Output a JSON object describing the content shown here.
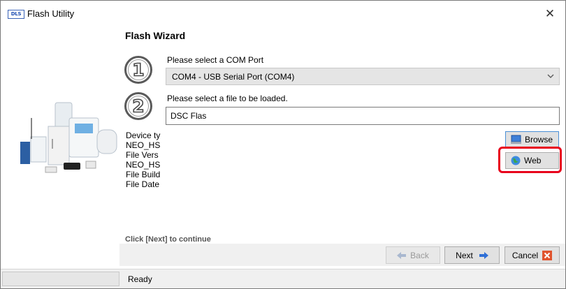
{
  "window": {
    "title": "Flash Utility",
    "app_icon_text": "DLS",
    "close_glyph": "✕"
  },
  "wizard": {
    "title": "Flash Wizard",
    "continue_text": "Click [Next] to continue"
  },
  "steps": [
    {
      "number": "1",
      "label": "Please select a COM Port"
    },
    {
      "number": "2",
      "label": "Please select a file to be loaded."
    }
  ],
  "com_port": {
    "selected": "COM4 - USB Serial Port (COM4)"
  },
  "file": {
    "value": "DSC Flas"
  },
  "info_lines": [
    "Device ty",
    "NEO_HS",
    "File Vers",
    "NEO_HS",
    "File Build",
    "File Date"
  ],
  "buttons": {
    "browse": "Browse",
    "web": "Web",
    "back": "Back",
    "next": "Next",
    "cancel": "Cancel"
  },
  "status": {
    "text": "Ready"
  },
  "colors": {
    "highlight": "#e8001c",
    "arrow": "#2f6fd6",
    "cancel_icon": "#e0542e"
  },
  "icons": {
    "browse": "computer-icon",
    "web": "globe-icon",
    "back": "left-arrow-icon",
    "next": "right-arrow-icon",
    "cancel": "x-box-icon",
    "close": "close-icon"
  }
}
